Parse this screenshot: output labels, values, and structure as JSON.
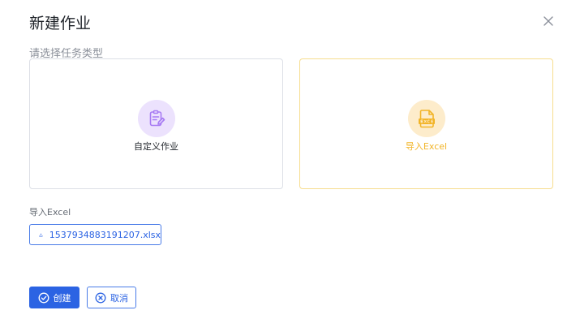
{
  "dialog": {
    "title": "新建作业",
    "subtitle": "请选择任务类型",
    "options": [
      {
        "label": "自定义作业",
        "icon": "clipboard-edit-icon",
        "accent": "#a77bf3",
        "background": "#ece2fd"
      },
      {
        "label": "导入Excel",
        "icon": "excel-file-icon",
        "accent": "#f2b427",
        "background": "#fdeccb",
        "selected": true
      }
    ],
    "file_section": {
      "label": "导入Excel",
      "file_name": "1537934883191207.xlsx",
      "icon": "download-icon"
    },
    "buttons": {
      "create": "创建",
      "cancel": "取消"
    },
    "colors": {
      "primary": "#2b63e3",
      "selected_border": "#f7dd8e"
    }
  }
}
